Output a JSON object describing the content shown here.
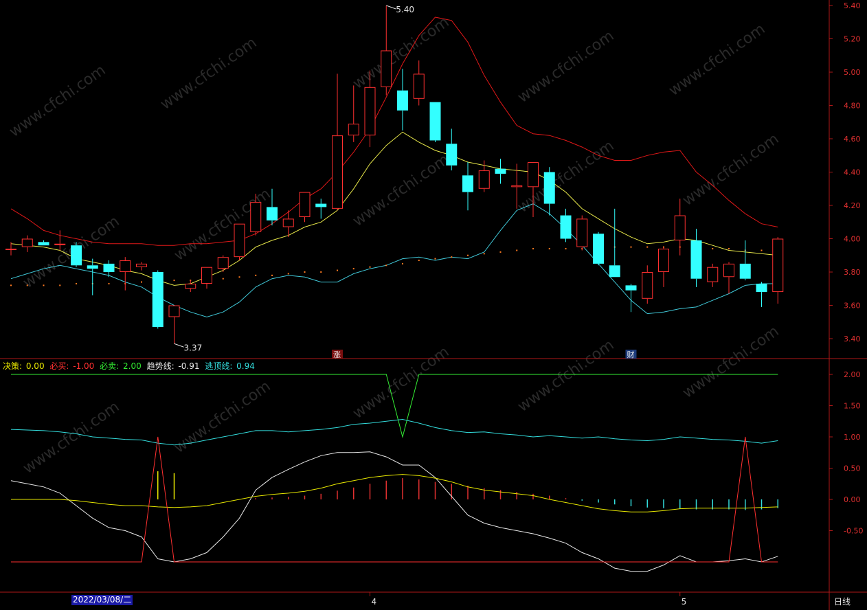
{
  "chart_data": [
    {
      "type": "candlestick",
      "ylim": [
        3.3,
        5.45
      ],
      "yticks": [
        "5.40",
        "5.20",
        "5.00",
        "4.80",
        "4.60",
        "4.40",
        "4.20",
        "4.00",
        "3.80",
        "3.60",
        "3.40"
      ],
      "candles": [
        {
          "o": 3.94,
          "h": 3.98,
          "l": 3.9,
          "c": 3.94,
          "up": true
        },
        {
          "o": 3.95,
          "h": 4.02,
          "l": 3.92,
          "c": 4.0,
          "up": true
        },
        {
          "o": 3.98,
          "h": 3.99,
          "l": 3.96,
          "c": 3.96,
          "up": false
        },
        {
          "o": 3.97,
          "h": 4.05,
          "l": 3.93,
          "c": 3.97,
          "up": true
        },
        {
          "o": 3.96,
          "h": 3.98,
          "l": 3.83,
          "c": 3.84,
          "up": false
        },
        {
          "o": 3.84,
          "h": 3.88,
          "l": 3.66,
          "c": 3.82,
          "up": false
        },
        {
          "o": 3.85,
          "h": 3.87,
          "l": 3.77,
          "c": 3.8,
          "up": false
        },
        {
          "o": 3.8,
          "h": 3.89,
          "l": 3.69,
          "c": 3.87,
          "up": true
        },
        {
          "o": 3.83,
          "h": 3.86,
          "l": 3.81,
          "c": 3.85,
          "up": true
        },
        {
          "o": 3.8,
          "h": 3.81,
          "l": 3.46,
          "c": 3.47,
          "up": false
        },
        {
          "o": 3.53,
          "h": 3.6,
          "l": 3.37,
          "c": 3.6,
          "up": true
        },
        {
          "o": 3.7,
          "h": 3.75,
          "l": 3.68,
          "c": 3.73,
          "up": true
        },
        {
          "o": 3.73,
          "h": 3.83,
          "l": 3.7,
          "c": 3.83,
          "up": true
        },
        {
          "o": 3.82,
          "h": 3.9,
          "l": 3.8,
          "c": 3.89,
          "up": true
        },
        {
          "o": 3.89,
          "h": 4.09,
          "l": 3.87,
          "c": 4.09,
          "up": true
        },
        {
          "o": 4.04,
          "h": 4.27,
          "l": 4.02,
          "c": 4.22,
          "up": true
        },
        {
          "o": 4.19,
          "h": 4.3,
          "l": 4.08,
          "c": 4.11,
          "up": false
        },
        {
          "o": 4.07,
          "h": 4.17,
          "l": 4.01,
          "c": 4.12,
          "up": true
        },
        {
          "o": 4.13,
          "h": 4.28,
          "l": 4.1,
          "c": 4.28,
          "up": true
        },
        {
          "o": 4.21,
          "h": 4.24,
          "l": 4.12,
          "c": 4.19,
          "up": false
        },
        {
          "o": 4.18,
          "h": 4.99,
          "l": 4.17,
          "c": 4.62,
          "up": true
        },
        {
          "o": 4.62,
          "h": 4.92,
          "l": 4.58,
          "c": 4.69,
          "up": true
        },
        {
          "o": 4.62,
          "h": 5.01,
          "l": 4.55,
          "c": 4.91,
          "up": true
        },
        {
          "o": 4.91,
          "h": 5.4,
          "l": 4.86,
          "c": 5.13,
          "up": true
        },
        {
          "o": 4.89,
          "h": 5.02,
          "l": 4.65,
          "c": 4.77,
          "up": false
        },
        {
          "o": 4.84,
          "h": 5.07,
          "l": 4.8,
          "c": 4.99,
          "up": true
        },
        {
          "o": 4.82,
          "h": 4.82,
          "l": 4.58,
          "c": 4.59,
          "up": false
        },
        {
          "o": 4.57,
          "h": 4.66,
          "l": 4.41,
          "c": 4.44,
          "up": false
        },
        {
          "o": 4.38,
          "h": 4.46,
          "l": 4.17,
          "c": 4.28,
          "up": false
        },
        {
          "o": 4.3,
          "h": 4.47,
          "l": 4.28,
          "c": 4.41,
          "up": true
        },
        {
          "o": 4.42,
          "h": 4.48,
          "l": 4.33,
          "c": 4.39,
          "up": false
        },
        {
          "o": 4.31,
          "h": 4.45,
          "l": 4.18,
          "c": 4.32,
          "up": true
        },
        {
          "o": 4.31,
          "h": 4.45,
          "l": 4.13,
          "c": 4.46,
          "up": true
        },
        {
          "o": 4.4,
          "h": 4.43,
          "l": 4.14,
          "c": 4.21,
          "up": false
        },
        {
          "o": 4.14,
          "h": 4.18,
          "l": 3.98,
          "c": 4.0,
          "up": false
        },
        {
          "o": 3.95,
          "h": 4.14,
          "l": 3.93,
          "c": 4.12,
          "up": true
        },
        {
          "o": 4.03,
          "h": 4.04,
          "l": 3.84,
          "c": 3.85,
          "up": false
        },
        {
          "o": 3.84,
          "h": 4.18,
          "l": 3.77,
          "c": 3.77,
          "up": false
        },
        {
          "o": 3.72,
          "h": 3.73,
          "l": 3.56,
          "c": 3.69,
          "up": false
        },
        {
          "o": 3.64,
          "h": 3.84,
          "l": 3.61,
          "c": 3.8,
          "up": true
        },
        {
          "o": 3.8,
          "h": 3.95,
          "l": 3.71,
          "c": 3.94,
          "up": true
        },
        {
          "o": 3.99,
          "h": 4.24,
          "l": 3.9,
          "c": 4.14,
          "up": true
        },
        {
          "o": 3.99,
          "h": 4.06,
          "l": 3.71,
          "c": 3.76,
          "up": false
        },
        {
          "o": 3.74,
          "h": 3.85,
          "l": 3.71,
          "c": 3.83,
          "up": true
        },
        {
          "o": 3.77,
          "h": 3.86,
          "l": 3.67,
          "c": 3.85,
          "up": true
        },
        {
          "o": 3.85,
          "h": 3.99,
          "l": 3.75,
          "c": 3.76,
          "up": false
        },
        {
          "o": 3.73,
          "h": 3.74,
          "l": 3.59,
          "c": 3.68,
          "up": false
        },
        {
          "o": 3.68,
          "h": 4.01,
          "l": 3.61,
          "c": 4.0,
          "up": true
        }
      ],
      "upper_band": [
        4.18,
        4.12,
        4.05,
        4.02,
        4.0,
        3.98,
        3.97,
        3.97,
        3.97,
        3.96,
        3.96,
        3.97,
        3.97,
        3.98,
        3.99,
        4.03,
        4.09,
        4.16,
        4.24,
        4.3,
        4.4,
        4.52,
        4.66,
        4.85,
        5.05,
        5.22,
        5.33,
        5.31,
        5.18,
        4.98,
        4.82,
        4.68,
        4.63,
        4.62,
        4.59,
        4.55,
        4.5,
        4.47,
        4.47,
        4.5,
        4.52,
        4.53,
        4.4,
        4.32,
        4.23,
        4.15,
        4.09,
        4.07
      ],
      "mid_line": [
        3.97,
        3.96,
        3.95,
        3.93,
        3.88,
        3.86,
        3.84,
        3.81,
        3.79,
        3.75,
        3.72,
        3.73,
        3.77,
        3.81,
        3.87,
        3.95,
        3.99,
        4.02,
        4.07,
        4.1,
        4.17,
        4.3,
        4.45,
        4.56,
        4.64,
        4.58,
        4.53,
        4.5,
        4.46,
        4.44,
        4.42,
        4.41,
        4.4,
        4.35,
        4.28,
        4.18,
        4.12,
        4.06,
        4.01,
        3.97,
        3.98,
        4.0,
        3.99,
        3.96,
        3.93,
        3.92,
        3.91,
        3.9
      ],
      "lower_band": [
        3.76,
        3.79,
        3.82,
        3.84,
        3.82,
        3.8,
        3.78,
        3.74,
        3.71,
        3.65,
        3.6,
        3.56,
        3.53,
        3.56,
        3.62,
        3.71,
        3.76,
        3.78,
        3.77,
        3.74,
        3.74,
        3.79,
        3.82,
        3.84,
        3.88,
        3.89,
        3.87,
        3.89,
        3.88,
        3.92,
        4.05,
        4.17,
        4.21,
        4.15,
        4.06,
        3.96,
        3.85,
        3.74,
        3.63,
        3.55,
        3.56,
        3.58,
        3.59,
        3.63,
        3.67,
        3.72,
        3.73,
        3.73
      ],
      "dots": [
        3.72,
        3.72,
        3.72,
        3.72,
        3.73,
        3.73,
        3.73,
        3.73,
        3.74,
        3.74,
        3.75,
        3.75,
        3.76,
        3.76,
        3.77,
        3.78,
        3.78,
        3.79,
        3.8,
        3.8,
        3.81,
        3.82,
        3.83,
        3.84,
        3.85,
        3.87,
        3.88,
        3.89,
        3.9,
        3.91,
        3.92,
        3.93,
        3.94,
        3.94,
        3.94,
        3.94,
        3.95,
        3.95,
        3.95,
        3.95,
        3.95,
        3.95,
        3.95,
        3.94,
        3.94,
        3.93,
        3.93,
        3.92
      ],
      "annotations": [
        {
          "text": "5.40",
          "index": 23,
          "value": 5.4
        },
        {
          "text": "3.37",
          "index": 10,
          "value": 3.37
        }
      ],
      "event_markers": [
        {
          "text": "涨",
          "index": 20
        },
        {
          "text": "财",
          "index": 38
        }
      ]
    },
    {
      "type": "line",
      "ylim": [
        -1.05,
        2.45
      ],
      "yticks": [
        "2.00",
        "1.50",
        "1.00",
        "0.50",
        "0.00",
        "-0.50"
      ],
      "legend": [
        {
          "label": "决策: ",
          "value": "0.00",
          "color": "#e8e800"
        },
        {
          "label": "必买: ",
          "value": "-1.00",
          "color": "#ff3030"
        },
        {
          "label": "必卖: ",
          "value": "2.00",
          "color": "#33ee33"
        },
        {
          "label": "趋势线: ",
          "value": "-0.91",
          "color": "#e8e8e8"
        },
        {
          "label": "逃顶线: ",
          "value": "0.94",
          "color": "#33dddd"
        }
      ],
      "series": [
        {
          "name": "必卖",
          "values": [
            2,
            2,
            2,
            2,
            2,
            2,
            2,
            2,
            2,
            2,
            2,
            2,
            2,
            2,
            2,
            2,
            2,
            2,
            2,
            2,
            2,
            2,
            2,
            2,
            1,
            2,
            2,
            2,
            2,
            2,
            2,
            2,
            2,
            2,
            2,
            2,
            2,
            2,
            2,
            2,
            2,
            2,
            2,
            2,
            2,
            2,
            2,
            2
          ]
        },
        {
          "name": "逃顶线",
          "values": [
            1.12,
            1.11,
            1.1,
            1.08,
            1.05,
            1.0,
            0.98,
            0.96,
            0.95,
            0.9,
            0.87,
            0.9,
            0.95,
            1.0,
            1.05,
            1.1,
            1.1,
            1.08,
            1.1,
            1.12,
            1.15,
            1.2,
            1.22,
            1.25,
            1.28,
            1.22,
            1.15,
            1.1,
            1.07,
            1.08,
            1.05,
            1.03,
            1.0,
            1.02,
            1.0,
            0.98,
            1.0,
            0.97,
            0.95,
            0.94,
            0.96,
            1.0,
            0.98,
            0.96,
            0.95,
            0.93,
            0.9,
            0.94
          ]
        },
        {
          "name": "趋势线",
          "values": [
            0.3,
            0.25,
            0.2,
            0.1,
            -0.1,
            -0.3,
            -0.45,
            -0.5,
            -0.6,
            -0.95,
            -1.0,
            -0.95,
            -0.85,
            -0.6,
            -0.3,
            0.15,
            0.35,
            0.48,
            0.6,
            0.7,
            0.75,
            0.75,
            0.76,
            0.68,
            0.55,
            0.55,
            0.35,
            0.05,
            -0.25,
            -0.38,
            -0.45,
            -0.5,
            -0.55,
            -0.62,
            -0.7,
            -0.85,
            -0.95,
            -1.1,
            -1.15,
            -1.15,
            -1.05,
            -0.9,
            -1.0,
            -1.0,
            -0.98,
            -0.95,
            -1.0,
            -0.91
          ]
        },
        {
          "name": "决策",
          "values": [
            0.0,
            0.0,
            0.0,
            0.0,
            -0.02,
            -0.05,
            -0.08,
            -0.1,
            -0.1,
            -0.12,
            -0.13,
            -0.12,
            -0.1,
            -0.05,
            0.0,
            0.05,
            0.08,
            0.1,
            0.13,
            0.18,
            0.25,
            0.3,
            0.35,
            0.38,
            0.4,
            0.38,
            0.34,
            0.28,
            0.2,
            0.15,
            0.12,
            0.09,
            0.06,
            0.0,
            -0.05,
            -0.1,
            -0.15,
            -0.18,
            -0.2,
            -0.2,
            -0.18,
            -0.15,
            -0.14,
            -0.14,
            -0.14,
            -0.14,
            -0.13,
            -0.12
          ]
        },
        {
          "name": "必买",
          "values": [
            -1,
            -1,
            -1,
            -1,
            -1,
            -1,
            -1,
            -1,
            -1,
            1,
            -1,
            -1,
            -1,
            -1,
            -1,
            -1,
            -1,
            -1,
            -1,
            -1,
            -1,
            -1,
            -1,
            -1,
            -1,
            -1,
            -1,
            -1,
            -1,
            -1,
            -1,
            -1,
            -1,
            -1,
            -1,
            -1,
            -1,
            -1,
            -1,
            -1,
            -1,
            -1,
            -1,
            -1,
            -1,
            1,
            -1,
            -1
          ]
        }
      ],
      "bars": [
        0,
        0,
        0,
        0,
        0,
        0,
        0,
        0,
        0,
        0.45,
        0.42,
        0,
        0,
        0,
        0,
        0.02,
        0.03,
        0.04,
        0.06,
        0.09,
        0.14,
        0.19,
        0.25,
        0.3,
        0.34,
        0.32,
        0.28,
        0.25,
        0.22,
        0.18,
        0.15,
        0.12,
        0.09,
        0.06,
        0.02,
        -0.02,
        -0.05,
        -0.08,
        -0.11,
        -0.13,
        -0.14,
        -0.15,
        -0.16,
        -0.16,
        -0.16,
        -0.17,
        -0.16,
        -0.14
      ]
    }
  ],
  "x_axis": {
    "date_label": "2022/03/08/二",
    "month_labels": [
      {
        "text": "4",
        "index": 22
      },
      {
        "text": "5",
        "index": 41
      }
    ],
    "period": "日线"
  },
  "watermark": "www.cfchi.com",
  "colors": {
    "up": "#ff3030",
    "down": "#33ffff",
    "upper_band": "#e01818",
    "mid_line": "#e8e84a",
    "lower_band": "#40c8d8",
    "dots": "#ff7a20",
    "axis": "#b01818",
    "tick": "#e03030"
  }
}
